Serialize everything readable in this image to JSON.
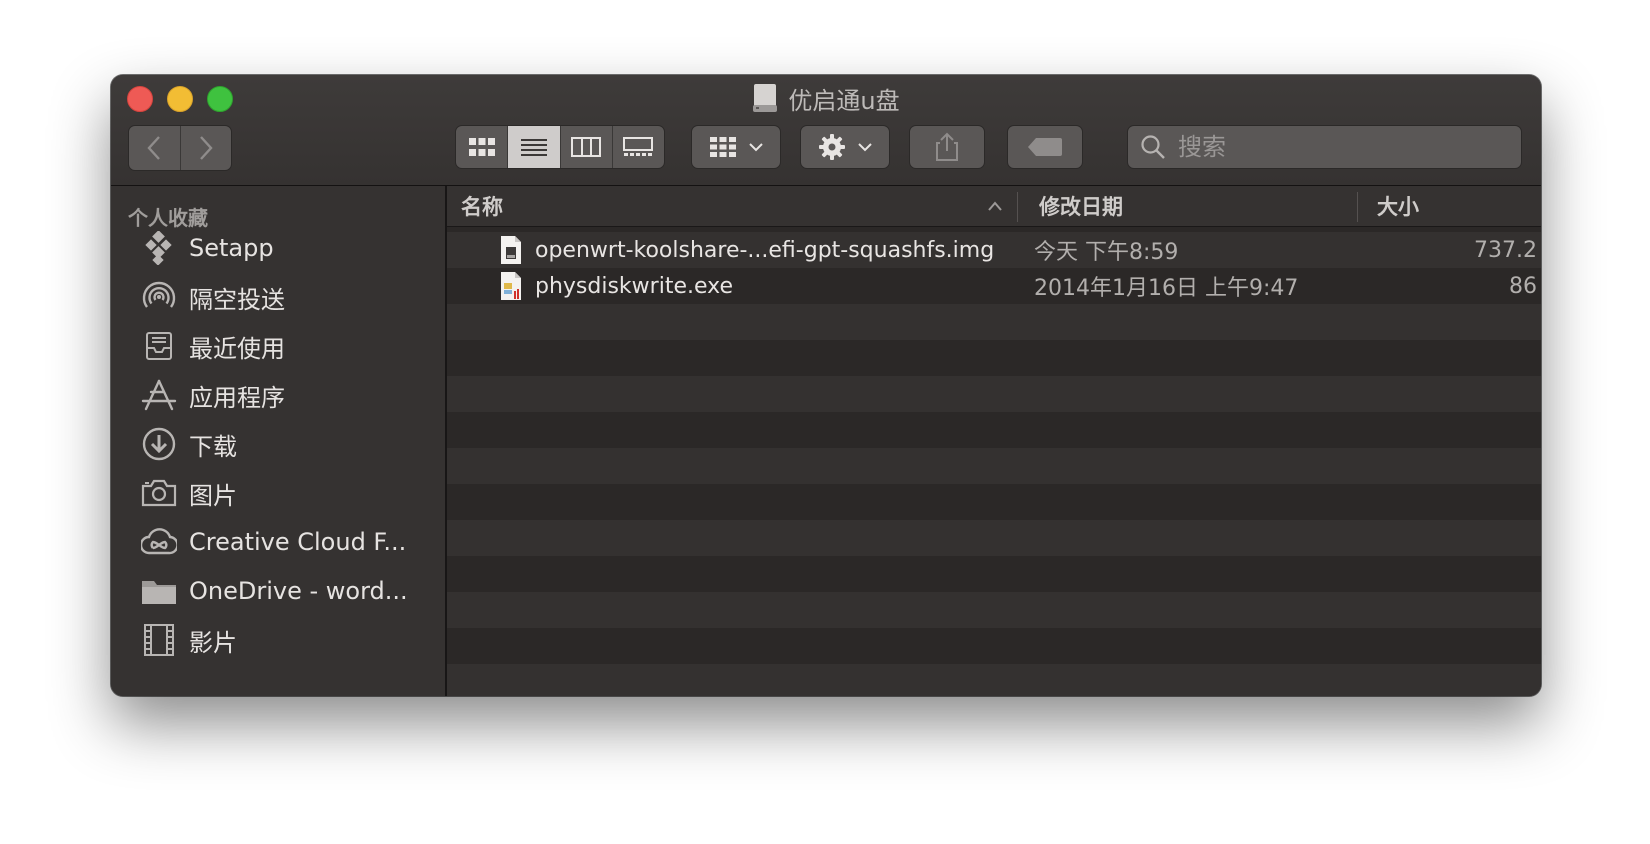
{
  "window": {
    "title": "优启通u盘"
  },
  "toolbar": {
    "back_icon": "chevron-left-icon",
    "forward_icon": "chevron-right-icon",
    "view_modes": [
      "icon-view-icon",
      "list-view-icon",
      "column-view-icon",
      "gallery-view-icon"
    ],
    "active_view": "list",
    "search_placeholder": "搜索"
  },
  "sidebar": {
    "section_title": "个人收藏",
    "items": [
      {
        "label": "Setapp",
        "icon": "setapp-icon"
      },
      {
        "label": "隔空投送",
        "icon": "airdrop-icon"
      },
      {
        "label": "最近使用",
        "icon": "recents-icon"
      },
      {
        "label": "应用程序",
        "icon": "applications-icon"
      },
      {
        "label": "下载",
        "icon": "download-icon"
      },
      {
        "label": "图片",
        "icon": "camera-icon"
      },
      {
        "label": "Creative Cloud F...",
        "icon": "creative-cloud-icon"
      },
      {
        "label": "OneDrive - word...",
        "icon": "folder-icon"
      },
      {
        "label": "影片",
        "icon": "film-icon"
      }
    ]
  },
  "list": {
    "columns": {
      "name": "名称",
      "date": "修改日期",
      "size": "大小"
    },
    "files": [
      {
        "name": "openwrt-koolshare-...efi-gpt-squashfs.img",
        "date": "今天 下午8:59",
        "size": "737.2",
        "icon": "disk-image-icon"
      },
      {
        "name": "physdiskwrite.exe",
        "date": "2014年1月16日 上午9:47",
        "size": "86",
        "icon": "exe-file-icon"
      }
    ]
  }
}
